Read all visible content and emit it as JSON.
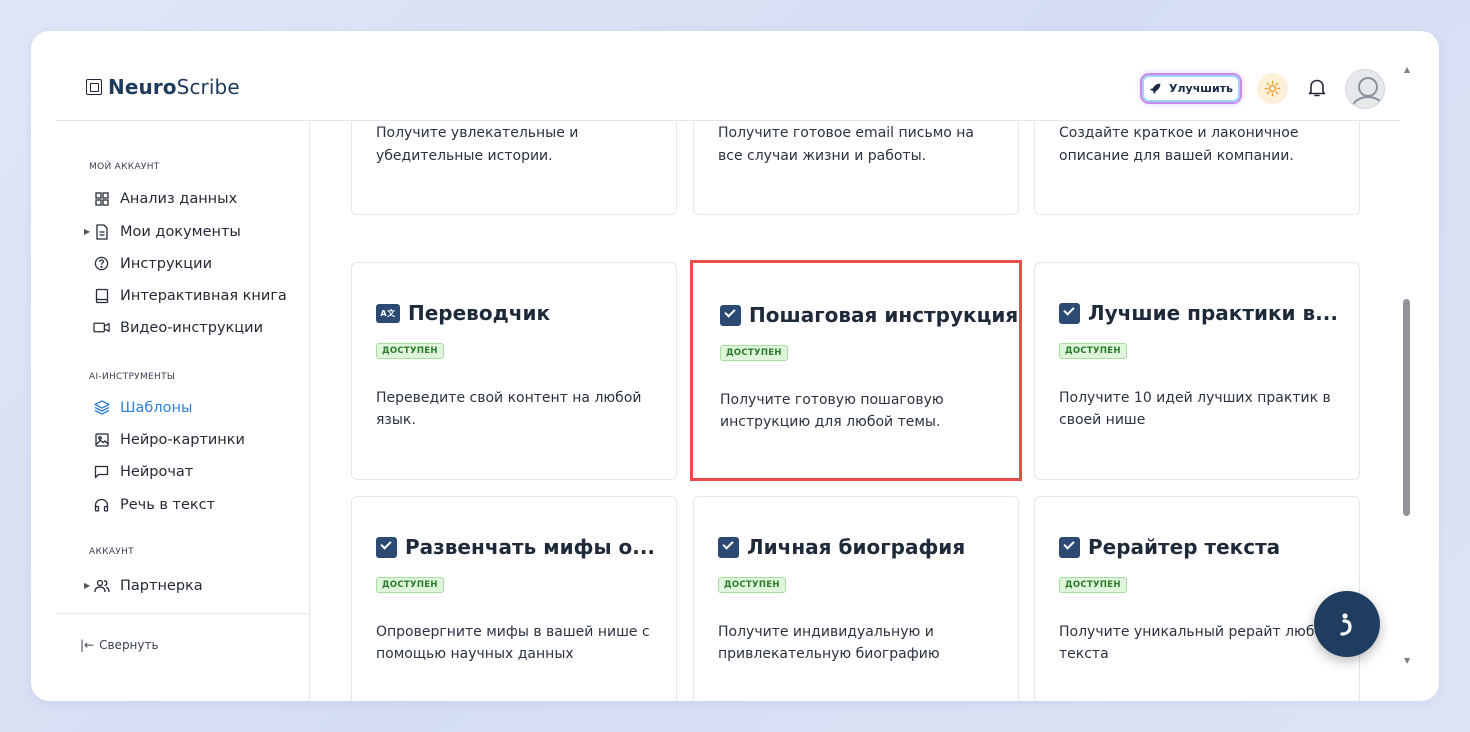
{
  "brand": {
    "bold": "Neuro",
    "light": "Scribe"
  },
  "header": {
    "upgrade_label": "Улучшить"
  },
  "sidebar": {
    "section_account": "МОЙ АККАУНТ",
    "account_items": [
      {
        "label": "Анализ данных",
        "icon": "grid-icon"
      },
      {
        "label": "Мои документы",
        "icon": "document-icon"
      },
      {
        "label": "Инструкции",
        "icon": "help-circle-icon"
      },
      {
        "label": "Интерактивная книга",
        "icon": "book-icon"
      },
      {
        "label": "Видео-инструкции",
        "icon": "video-icon"
      }
    ],
    "section_ai": "AI-ИНСТРУМЕНТЫ",
    "ai_items": [
      {
        "label": "Шаблоны",
        "icon": "layers-icon"
      },
      {
        "label": "Нейро-картинки",
        "icon": "image-icon"
      },
      {
        "label": "Нейрочат",
        "icon": "chat-icon"
      },
      {
        "label": "Речь в текст",
        "icon": "headphones-icon"
      }
    ],
    "section_acc": "АККАУНТ",
    "acc_items": [
      {
        "label": "Партнерка",
        "icon": "users-icon"
      }
    ],
    "collapse_label": "Свернуть"
  },
  "cards_top": [
    {
      "desc": "Получите увлекательные и убедительные истории."
    },
    {
      "desc": "Получите готовое email письмо на все случаи жизни и работы."
    },
    {
      "desc": "Создайте краткое и лаконичное описание для вашей компании."
    }
  ],
  "cards": [
    {
      "title": "Переводчик",
      "badge": "доступен",
      "desc": "Переведите свой контент на любой язык.",
      "icon": "translate-icon",
      "icon_text": "A文"
    },
    {
      "title": "Пошаговая инструкция",
      "badge": "доступен",
      "desc": "Получите готовую пошаговую инструкцию для любой темы.",
      "icon": "check-icon"
    },
    {
      "title": "Лучшие практики в...",
      "badge": "доступен",
      "desc": "Получите 10 идей лучших практик в своей нише",
      "icon": "check-icon"
    },
    {
      "title": "Развенчать мифы о...",
      "badge": "доступен",
      "desc": "Опровергните мифы в вашей нише с помощью научных данных",
      "icon": "check-icon"
    },
    {
      "title": "Личная биография",
      "badge": "доступен",
      "desc": "Получите индивидуальную и привлекательную биографию",
      "icon": "check-icon"
    },
    {
      "title": "Рерайтер текста",
      "badge": "доступен",
      "desc": "Получите уникальный рерайт любого текста",
      "icon": "check-icon"
    }
  ],
  "colors": {
    "accent": "#2f7fd6",
    "highlight": "#ea4b4b",
    "badge_bg": "#dff6dc",
    "navy": "#1f3d5e"
  }
}
